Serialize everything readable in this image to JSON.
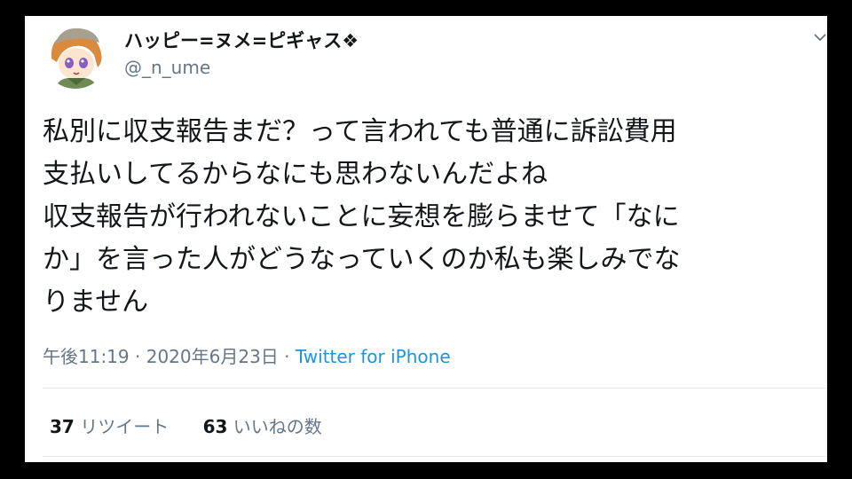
{
  "tweet": {
    "author": {
      "display_name": "ハッピー=ヌメ=ピギャス",
      "name_emoji": "❖",
      "handle": "@_n_ume"
    },
    "text_lines": [
      "私別に収支報告まだ？って言われても普通に訴訟費用",
      "支払いしてるからなにも思わないんだよね",
      "収支報告が行われないことに妄想を膨らませて「なに",
      "か」を言った人がどうなっていくのか私も楽しみでな",
      "りません"
    ],
    "time": "午後11:19",
    "separator": "·",
    "date": "2020年6月23日",
    "source": "Twitter for iPhone",
    "retweets": {
      "count": "37",
      "label": "リツイート"
    },
    "likes": {
      "count": "63",
      "label": "いいねの数"
    }
  },
  "colors": {
    "text": "#14171a",
    "muted": "#657786",
    "link": "#1b95e0",
    "divider": "#e6ecf0"
  },
  "icons": {
    "caret": "chevron-down-icon",
    "avatar": "user-avatar"
  }
}
